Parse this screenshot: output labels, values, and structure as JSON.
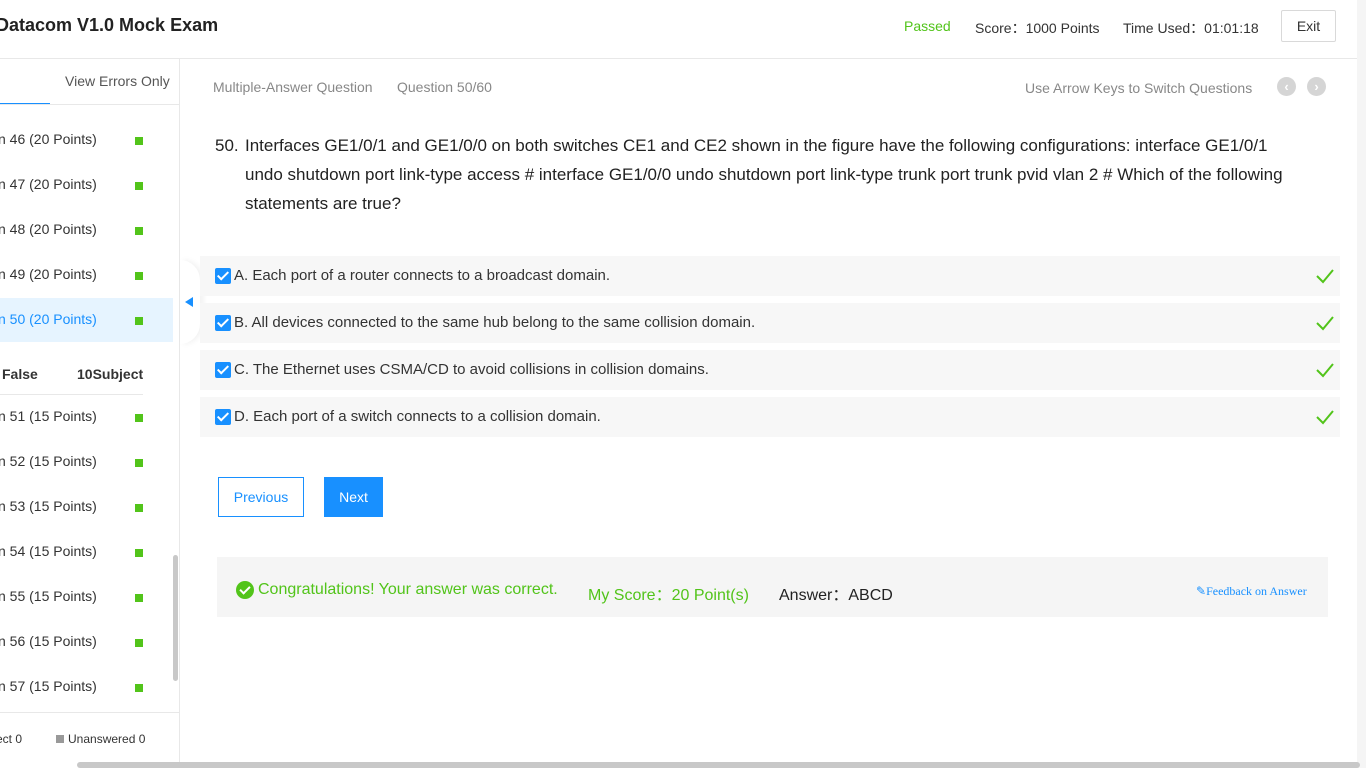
{
  "header": {
    "title": "Datacom V1.0 Mock Exam",
    "status": "Passed",
    "score": "Score：1000 Points",
    "time_used": "Time Used：01:01:18",
    "exit_label": "Exit",
    "status_color": "#52c41a"
  },
  "sidebar": {
    "tab_errors_label": "View Errors Only",
    "questions_multi": [
      {
        "label": "n 46   (20 Points)"
      },
      {
        "label": "n 47   (20 Points)"
      },
      {
        "label": "n 48   (20 Points)"
      },
      {
        "label": "n 49   (20 Points)"
      },
      {
        "label": "n 50   (20 Points)",
        "active": true
      }
    ],
    "section": {
      "col1": "False",
      "col2": "10Subject"
    },
    "questions_tf": [
      {
        "label": "n 51   (15 Points)"
      },
      {
        "label": "n 52   (15 Points)"
      },
      {
        "label": "n 53   (15 Points)"
      },
      {
        "label": "n 54   (15 Points)"
      },
      {
        "label": "n 55   (15 Points)"
      },
      {
        "label": "n 56   (15 Points)"
      },
      {
        "label": "n 57   (15 Points)"
      }
    ],
    "footer": {
      "incorrect": "ect 0",
      "unanswered": "Unanswered 0"
    }
  },
  "main": {
    "question_type": "Multiple-Answer Question",
    "question_number": "Question 50/60",
    "hint": "Use Arrow Keys to Switch Questions",
    "prev_icon": "chevron-left-icon",
    "next_icon": "chevron-right-icon",
    "question_num": "50.",
    "question_text": "Interfaces GE1/0/1 and GE1/0/0 on both switches CE1 and CE2 shown in the figure have the following configurations: interface GE1/0/1 undo shutdown port link-type access # interface GE1/0/0 undo shutdown port link-type trunk port trunk pvid vlan 2 # Which of the following statements are true?",
    "options": [
      {
        "text": "A. Each port of a router connects to a broadcast domain.",
        "checked": true,
        "correct": true
      },
      {
        "text": "B. All devices connected to the same hub belong to the same collision domain.",
        "checked": true,
        "correct": true
      },
      {
        "text": "C. The Ethernet uses CSMA/CD to avoid collisions in collision domains.",
        "checked": true,
        "correct": true
      },
      {
        "text": "D. Each port of a switch connects to a collision domain.",
        "checked": true,
        "correct": true
      }
    ],
    "previous_label": "Previous",
    "next_label": "Next",
    "result": {
      "message": "Congratulations! Your answer was correct.",
      "my_score": "My Score：20 Point(s)",
      "answer": "Answer：ABCD",
      "feedback": "Feedback on Answer"
    },
    "accent_color": "#1890ff",
    "success_color": "#52c41a"
  }
}
